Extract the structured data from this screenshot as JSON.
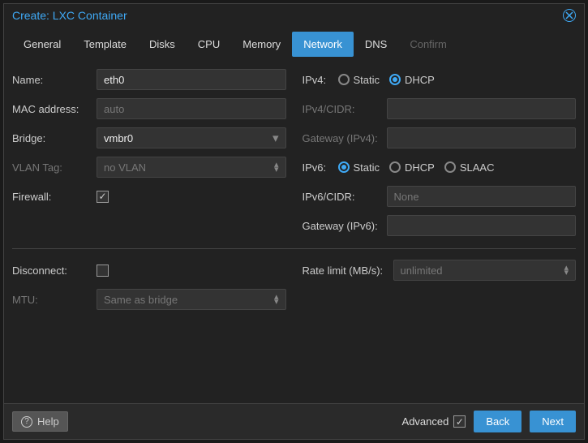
{
  "title": "Create: LXC Container",
  "tabs": [
    {
      "label": "General",
      "active": false
    },
    {
      "label": "Template",
      "active": false
    },
    {
      "label": "Disks",
      "active": false
    },
    {
      "label": "CPU",
      "active": false
    },
    {
      "label": "Memory",
      "active": false
    },
    {
      "label": "Network",
      "active": true
    },
    {
      "label": "DNS",
      "active": false
    },
    {
      "label": "Confirm",
      "active": false,
      "disabled": true
    }
  ],
  "left": {
    "name_label": "Name:",
    "name_value": "eth0",
    "mac_label": "MAC address:",
    "mac_placeholder": "auto",
    "bridge_label": "Bridge:",
    "bridge_value": "vmbr0",
    "vlan_label": "VLAN Tag:",
    "vlan_placeholder": "no VLAN",
    "firewall_label": "Firewall:",
    "firewall_checked": true,
    "disconnect_label": "Disconnect:",
    "disconnect_checked": false,
    "mtu_label": "MTU:",
    "mtu_placeholder": "Same as bridge"
  },
  "right": {
    "ipv4_label": "IPv4:",
    "ipv4_options": [
      "Static",
      "DHCP"
    ],
    "ipv4_selected": "DHCP",
    "ipv4cidr_label": "IPv4/CIDR:",
    "gw4_label": "Gateway (IPv4):",
    "ipv6_label": "IPv6:",
    "ipv6_options": [
      "Static",
      "DHCP",
      "SLAAC"
    ],
    "ipv6_selected": "Static",
    "ipv6cidr_label": "IPv6/CIDR:",
    "ipv6cidr_placeholder": "None",
    "gw6_label": "Gateway (IPv6):",
    "rate_label": "Rate limit (MB/s):",
    "rate_placeholder": "unlimited"
  },
  "footer": {
    "help": "Help",
    "advanced": "Advanced",
    "advanced_checked": true,
    "back": "Back",
    "next": "Next"
  }
}
